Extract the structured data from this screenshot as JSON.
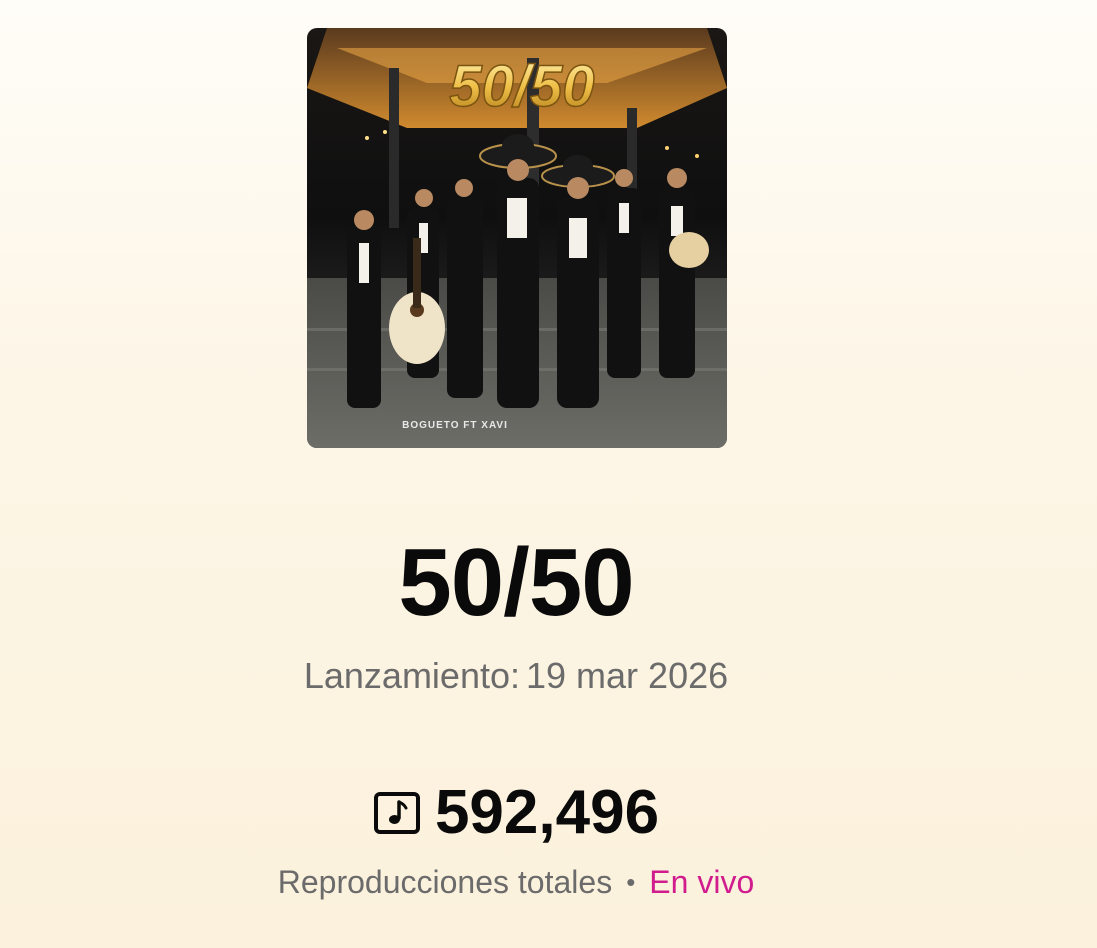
{
  "cover": {
    "title_art": "50/50",
    "credit_art": "BOGUETO FT XAVI"
  },
  "track": {
    "title": "50/50",
    "release_label": "Lanzamiento:",
    "release_date": "19 mar 2026"
  },
  "plays": {
    "icon": "music-note-icon",
    "count": "592,496",
    "label": "Reproducciones totales",
    "separator": "•",
    "live_label": "En vivo",
    "live_color": "#d11c8e"
  }
}
